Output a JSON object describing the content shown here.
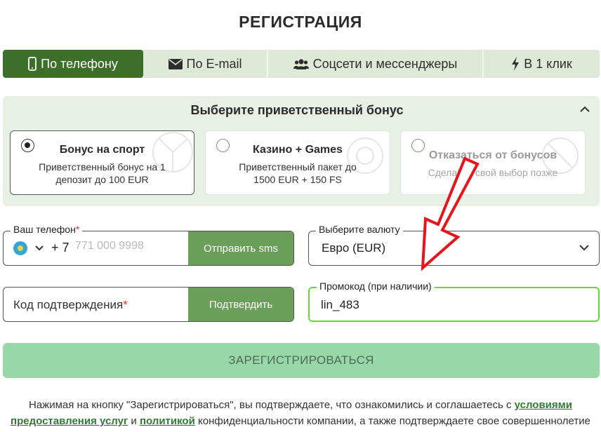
{
  "page": {
    "title": "РЕГИСТРАЦИЯ"
  },
  "tabs": [
    {
      "label": "По телефону",
      "icon": "mobile-phone-icon",
      "active": true
    },
    {
      "label": "По E-mail",
      "icon": "envelope-icon",
      "active": false
    },
    {
      "label": "Соцсети и мессенджеры",
      "icon": "users-icon",
      "active": false
    },
    {
      "label": "В 1 клик",
      "icon": "lightning-icon",
      "active": false
    }
  ],
  "bonus": {
    "title": "Выберите приветственный бонус",
    "options": [
      {
        "name": "Бонус на спорт",
        "desc": "Приветственный бонус на 1 депозит до 100 EUR",
        "selected": true
      },
      {
        "name": "Казино + Games",
        "desc": "Приветственный пакет до 1500 EUR + 150 FS",
        "selected": false
      },
      {
        "name": "Отказаться от бонусов",
        "desc": "Сделайте свой выбор позже",
        "selected": false
      }
    ]
  },
  "phone": {
    "label": "Ваш телефон",
    "required_mark": "*",
    "dial_code": "+ 7",
    "placeholder": "771 000 9998",
    "send_sms": "Отправить sms"
  },
  "currency": {
    "label": "Выберите валюту",
    "value": "Евро (EUR)"
  },
  "code": {
    "label": "Код подтверждения",
    "required_mark": "*",
    "confirm": "Подтвердить"
  },
  "promo": {
    "label": "Промокод (при наличии)",
    "value": "lin_483"
  },
  "register": {
    "label": "ЗАРЕГИСТРИРОВАТЬСЯ"
  },
  "terms": {
    "text1": "Нажимая на кнопку \"Зарегистрироваться\", вы подтверждаете, что ознакомились и соглашаетесь с ",
    "link1": "условиями предоставления услуг",
    "text2": " и ",
    "link2": "политикой",
    "text3": " конфиденциальности компании, а также подтверждаете свое совершеннолетие"
  },
  "colors": {
    "active_tab": "#3d6e2a",
    "tab_bg": "#dfe9d8",
    "panel_bg": "#e8efe4",
    "button_green": "#6a9f5a",
    "register_bg": "#98d8a8",
    "promo_border": "#67d936",
    "link": "#2f7d32",
    "arrow": "#e8141b"
  }
}
